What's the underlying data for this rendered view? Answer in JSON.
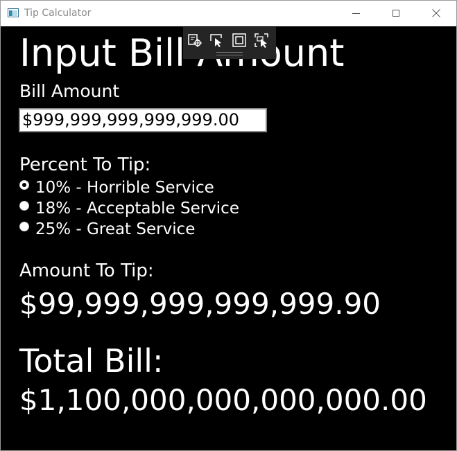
{
  "window": {
    "title": "Tip Calculator",
    "buttons": {
      "minimize": "minimize",
      "maximize": "maximize",
      "close": "close"
    }
  },
  "devbar": {
    "tools": [
      "select-element-icon",
      "pointer-icon",
      "display-layout-adorners-icon",
      "track-focus-icon"
    ]
  },
  "main": {
    "heading": "Input Bill Amount",
    "bill_label": "Bill Amount",
    "bill_value": "$999,999,999,999,999.00",
    "percent_label": "Percent To Tip:",
    "options": [
      {
        "label": "10% - Horrible Service",
        "selected": true
      },
      {
        "label": "18% - Acceptable Service",
        "selected": false
      },
      {
        "label": "25% - Great Service",
        "selected": false
      }
    ],
    "amount_label": "Amount To Tip:",
    "amount_value": "$99,999,999,999,999.90",
    "total_label": "Total Bill:",
    "total_value": "$1,100,000,000,000,000.00"
  },
  "colors": {
    "background": "#000000",
    "text": "#ffffff",
    "titlebar": "#ffffff",
    "devbar": "#252525"
  }
}
